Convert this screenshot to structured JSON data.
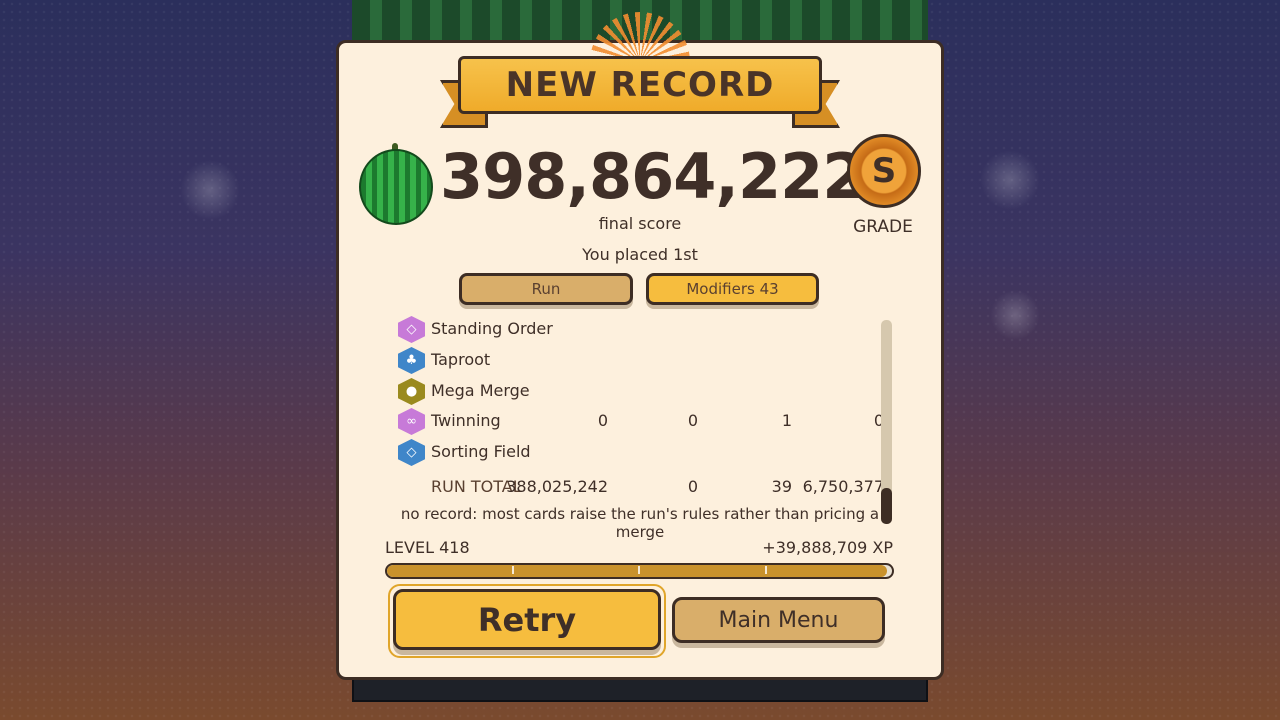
{
  "header": {
    "title": "NEW RECORD"
  },
  "score": {
    "value": "398,864,222",
    "label": "final score"
  },
  "grade": {
    "letter": "S",
    "label": "GRADE"
  },
  "placement": "You placed 1st",
  "tabs": [
    {
      "label": "Run",
      "active": false
    },
    {
      "label": "Modifiers  43",
      "active": true
    }
  ],
  "modifiers": [
    {
      "name": "Standing Order",
      "icon": "diamond-card-icon",
      "values": [
        "",
        "",
        "",
        ""
      ],
      "color": "#c77ad8"
    },
    {
      "name": "Taproot",
      "icon": "root-icon",
      "values": [
        "",
        "",
        "",
        ""
      ],
      "color": "#3f86c9"
    },
    {
      "name": "Mega Merge",
      "icon": "melon-merge-icon",
      "values": [
        "",
        "",
        "",
        ""
      ],
      "color": "#9a8a1e"
    },
    {
      "name": "Twinning",
      "icon": "twin-orbs-icon",
      "values": [
        "0",
        "0",
        "1",
        "0"
      ],
      "color": "#c77ad8"
    },
    {
      "name": "Sorting Field",
      "icon": "diamond-card-icon",
      "values": [
        "",
        "",
        "",
        ""
      ],
      "color": "#3f86c9"
    }
  ],
  "run_total": {
    "label": "RUN TOTAL",
    "values": [
      "388,025,242",
      "0",
      "39",
      "6,750,377"
    ]
  },
  "note": "no record: most cards raise the run's rules rather than pricing a merge",
  "level": {
    "label": "LEVEL 418",
    "xp": "+39,888,709 XP",
    "progress": 0.99
  },
  "buttons": {
    "retry": "Retry",
    "main_menu": "Main Menu"
  },
  "colors": {
    "accent": "#f6bd3e",
    "panel": "#fdf0dd",
    "outline": "#3d2d24"
  }
}
